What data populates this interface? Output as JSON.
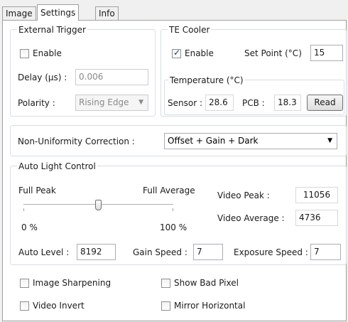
{
  "tabs": [
    {
      "label": "Image",
      "active": false
    },
    {
      "label": "Settings",
      "active": true
    },
    {
      "label": "Info",
      "active": false
    }
  ],
  "external_trigger": {
    "title": "External Trigger",
    "enable_label": "Enable",
    "enable_checked": false,
    "delay_label": "Delay (µs) :",
    "delay_value": "0.006",
    "polarity_label": "Polarity :",
    "polarity_value": "Rising Edge"
  },
  "te_cooler": {
    "title": "TE Cooler",
    "enable_label": "Enable",
    "enable_checked": true,
    "setpoint_label": "Set Point (°C)",
    "setpoint_value": "15",
    "temperature": {
      "title": "Temperature (°C)",
      "sensor_label": "Sensor :",
      "sensor_value": "28.6",
      "pcb_label": "PCB :",
      "pcb_value": "18.3",
      "read_button": "Read"
    }
  },
  "nuc": {
    "label": "Non-Uniformity Correction :",
    "value": "Offset + Gain + Dark"
  },
  "auto_light": {
    "title": "Auto Light Control",
    "full_peak_label": "Full Peak",
    "full_average_label": "Full Average",
    "min_label": "0 %",
    "max_label": "100 %",
    "slider_fraction": 0.5,
    "video_peak_label": "Video Peak :",
    "video_peak_value": "11056",
    "video_average_label": "Video Average :",
    "video_average_value": "4736",
    "auto_level_label": "Auto Level :",
    "auto_level_value": "8192",
    "gain_speed_label": "Gain Speed :",
    "gain_speed_value": "7",
    "exposure_speed_label": "Exposure Speed :",
    "exposure_speed_value": "7"
  },
  "options": {
    "image_sharpening": "Image Sharpening",
    "show_bad_pixel": "Show Bad Pixel",
    "video_invert": "Video Invert",
    "mirror_horizontal": "Mirror Horizontal"
  }
}
